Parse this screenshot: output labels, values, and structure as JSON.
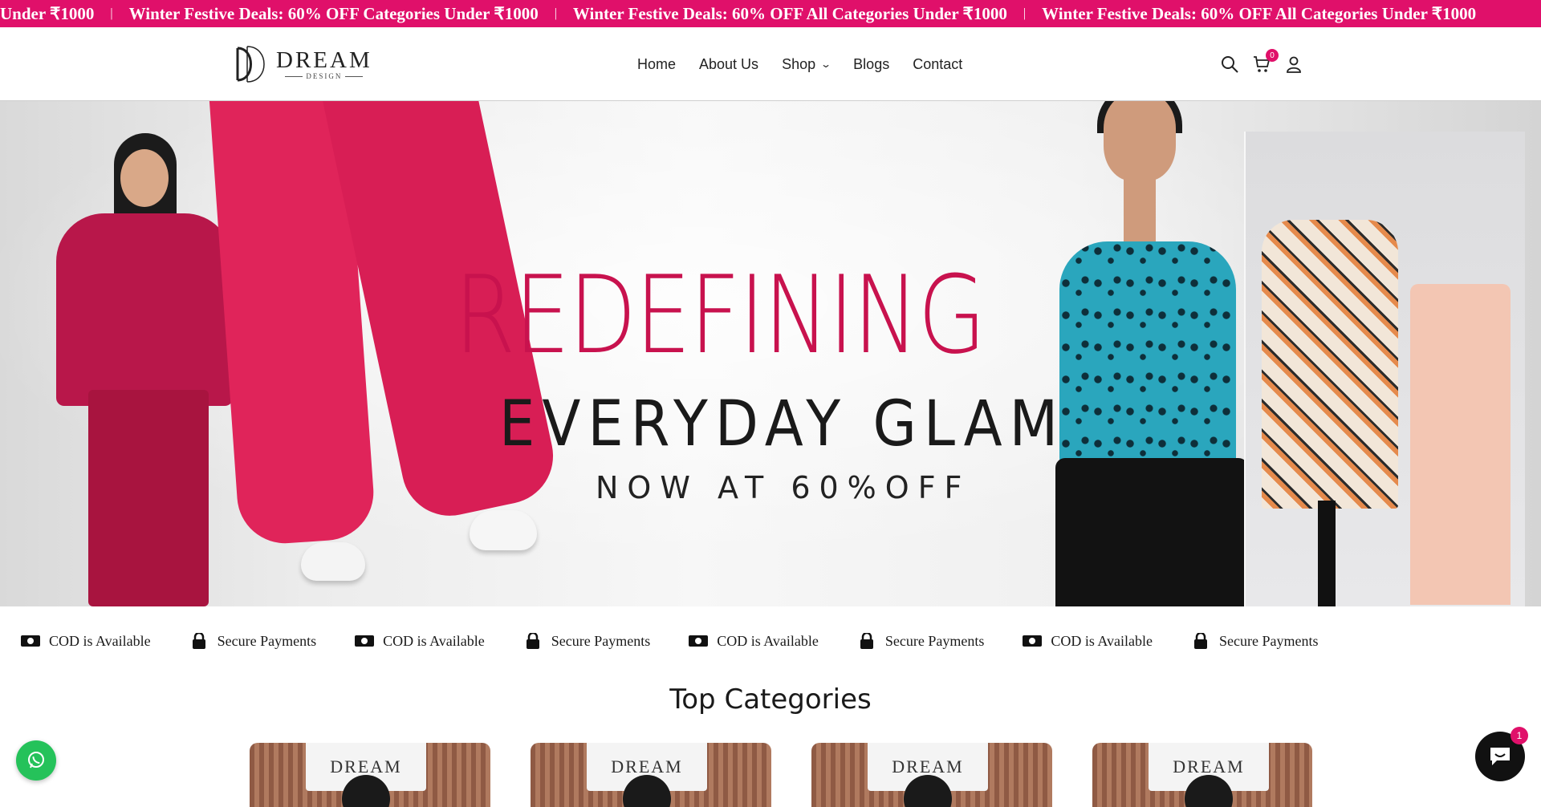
{
  "announcement": {
    "items": [
      "Under ₹1000",
      "Winter Festive Deals: 60% OFF Categories Under ₹1000",
      "Winter Festive Deals: 60% OFF All Categories Under ₹1000",
      "Winter Festive Deals: 60% OFF All Categories Under ₹1000"
    ],
    "separator": "|"
  },
  "brand": {
    "name": "DREAM",
    "sub": "DESIGN"
  },
  "nav": {
    "home": "Home",
    "about": "About Us",
    "shop": "Shop",
    "blogs": "Blogs",
    "contact": "Contact"
  },
  "header": {
    "cart_count": "0",
    "icons": [
      "search-icon",
      "cart-icon",
      "user-icon"
    ]
  },
  "hero": {
    "title": "REDEFINING",
    "subtitle": "EVERYDAY GLAM",
    "offer": "NOW AT 60%OFF"
  },
  "features": [
    {
      "icon": "cash-icon",
      "label": "COD is Available"
    },
    {
      "icon": "lock-icon",
      "label": "Secure Payments"
    },
    {
      "icon": "cash-icon",
      "label": "COD is Available"
    },
    {
      "icon": "lock-icon",
      "label": "Secure Payments"
    },
    {
      "icon": "cash-icon",
      "label": "COD is Available"
    },
    {
      "icon": "lock-icon",
      "label": "Secure Payments"
    },
    {
      "icon": "cash-icon",
      "label": "COD is Available"
    },
    {
      "icon": "lock-icon",
      "label": "Secure Payments"
    }
  ],
  "categories": {
    "title": "Top Categories",
    "card_sign": "DREAM"
  },
  "chat": {
    "badge": "1"
  },
  "colors": {
    "brand_pink": "#e0106a",
    "hero_title": "#c8124e",
    "whatsapp": "#25c25a"
  }
}
